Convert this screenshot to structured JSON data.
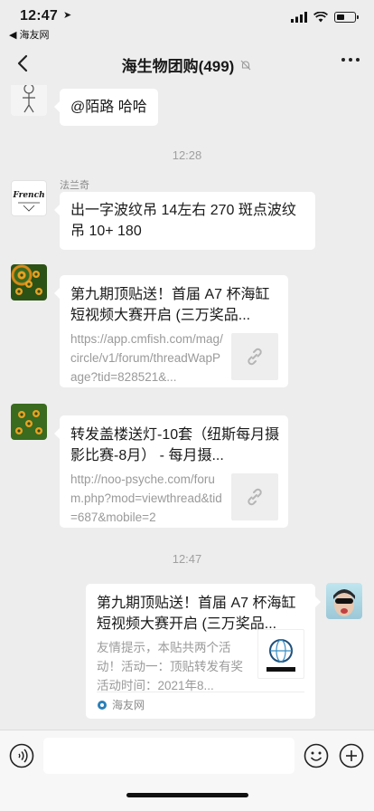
{
  "status": {
    "time": "12:47",
    "back_app": "◀ 海友网"
  },
  "header": {
    "title": "海生物团购(499)"
  },
  "timestamps": [
    "12:28",
    "12:47"
  ],
  "messages": {
    "m1": {
      "text": "@陌路 哈哈"
    },
    "m2": {
      "sender": "法兰奇",
      "avatar_text": "French",
      "text": "出一字波纹吊 14左右  270  斑点波纹吊 10+ 180"
    },
    "m3": {
      "title": "第九期顶贴送！首届 A7 杯海缸短视频大赛开启 (三万奖品...",
      "desc": "https://app.cmfish.com/mag/circle/v1/forum/threadWapPage?tid=828521&..."
    },
    "m4": {
      "title": "转发盖楼送灯-10套（纽斯每月摄影比赛-8月） - 每月摄...",
      "desc": "http://noo-psyche.com/forum.php?mod=viewthread&tid=687&mobile=2"
    },
    "m5": {
      "title": "第九期顶贴送！首届 A7 杯海缸短视频大赛开启 (三万奖品...",
      "desc": "友情提示，本贴共两个活动！活动一：顶贴转发有奖活动时间：2021年8...",
      "source": "海友网"
    }
  },
  "colors": {
    "background": "#ededed",
    "bubble": "#ffffff",
    "muted": "#a0a0a0"
  }
}
